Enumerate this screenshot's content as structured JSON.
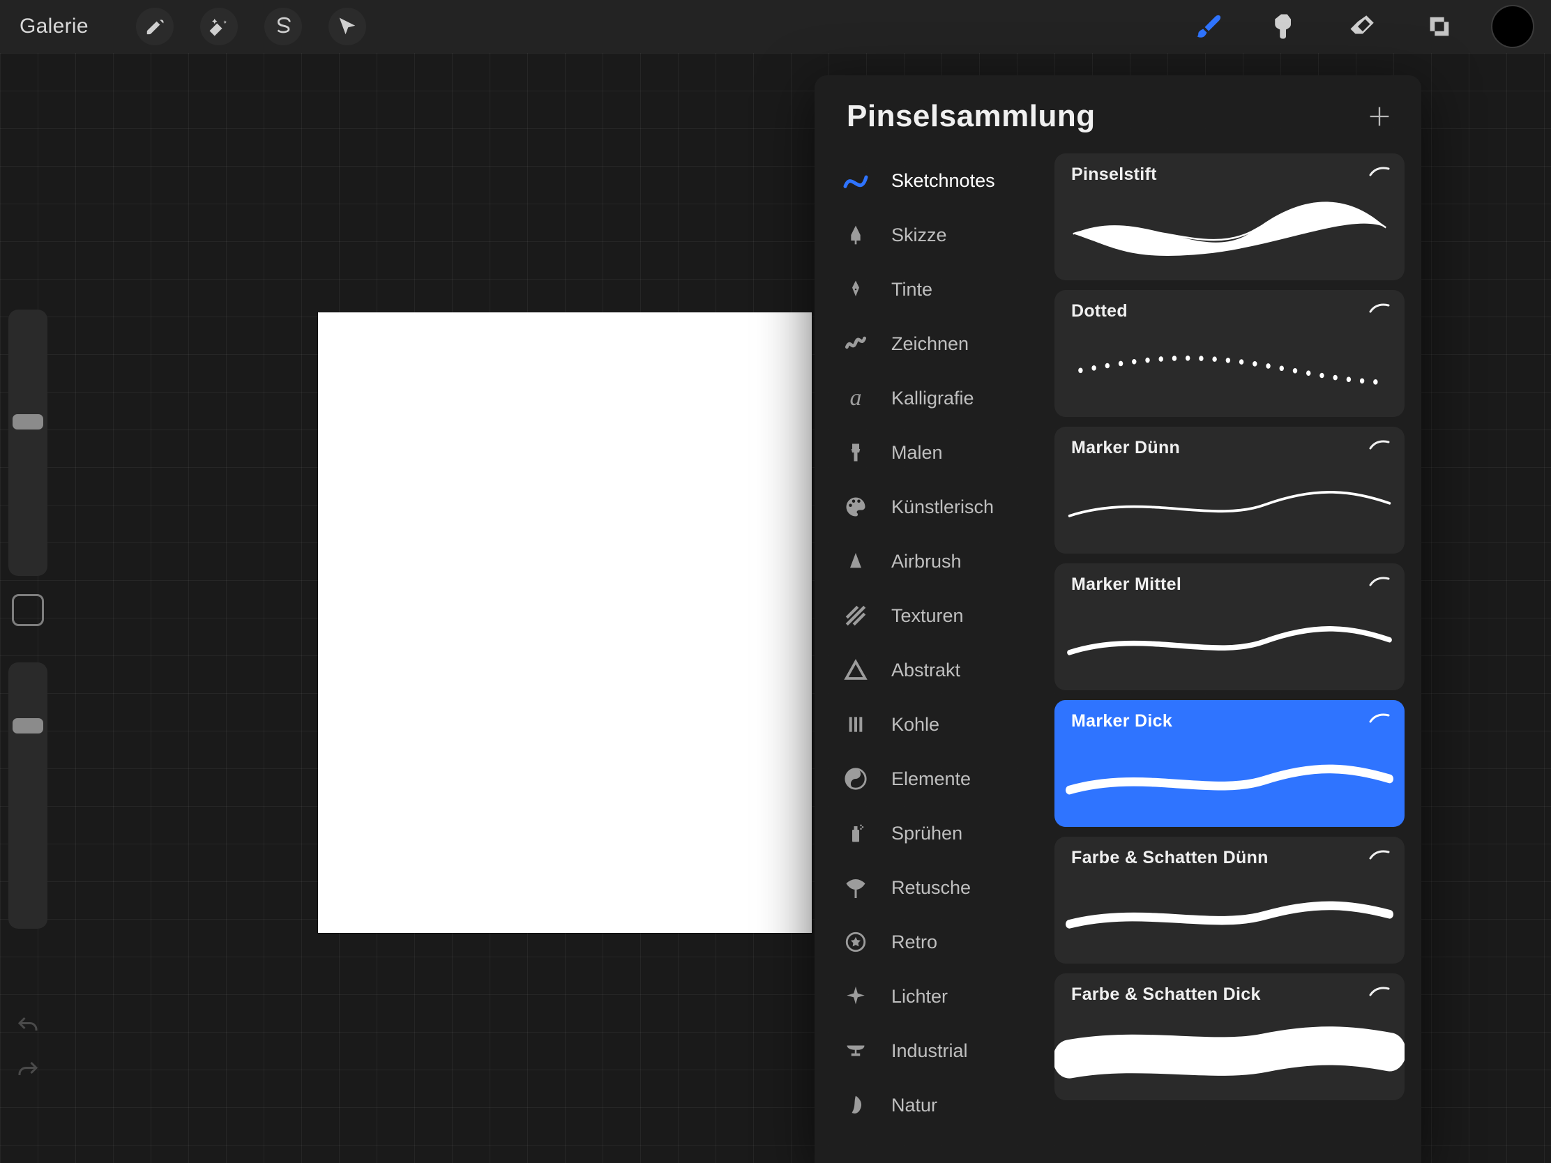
{
  "toolbar": {
    "gallery_label": "Galerie",
    "left_tools": [
      {
        "name": "wrench-icon"
      },
      {
        "name": "magic-wand-icon"
      },
      {
        "name": "select-s-icon"
      },
      {
        "name": "cursor-icon"
      }
    ],
    "right_tools": [
      {
        "name": "brush-icon",
        "active": true
      },
      {
        "name": "smudge-icon"
      },
      {
        "name": "eraser-icon"
      },
      {
        "name": "layers-icon"
      }
    ],
    "color": "#000000"
  },
  "sidebar": {
    "size_slider": 0.55,
    "opacity_slider": 0.78
  },
  "brush_library": {
    "title": "Pinselsammlung",
    "categories": [
      {
        "label": "Sketchnotes",
        "icon": "stroke-curve-icon",
        "active": true
      },
      {
        "label": "Skizze",
        "icon": "pencil-nib-icon"
      },
      {
        "label": "Tinte",
        "icon": "fountain-pen-icon"
      },
      {
        "label": "Zeichnen",
        "icon": "squiggle-icon"
      },
      {
        "label": "Kalligrafie",
        "icon": "cursive-a-icon"
      },
      {
        "label": "Malen",
        "icon": "flat-brush-icon"
      },
      {
        "label": "Künstlerisch",
        "icon": "palette-icon"
      },
      {
        "label": "Airbrush",
        "icon": "spray-cone-icon"
      },
      {
        "label": "Texturen",
        "icon": "hatch-icon"
      },
      {
        "label": "Abstrakt",
        "icon": "triangle-icon"
      },
      {
        "label": "Kohle",
        "icon": "bars-icon"
      },
      {
        "label": "Elemente",
        "icon": "yinyang-icon"
      },
      {
        "label": "Sprühen",
        "icon": "spray-can-icon"
      },
      {
        "label": "Retusche",
        "icon": "fan-brush-icon"
      },
      {
        "label": "Retro",
        "icon": "star-badge-icon"
      },
      {
        "label": "Lichter",
        "icon": "sparkle-icon"
      },
      {
        "label": "Industrial",
        "icon": "anvil-icon"
      },
      {
        "label": "Natur",
        "icon": "leaf-icon"
      }
    ],
    "brushes": [
      {
        "name": "Pinselstift",
        "type": "swell",
        "selected": false
      },
      {
        "name": "Dotted",
        "type": "dotted",
        "selected": false
      },
      {
        "name": "Marker Dünn",
        "type": "thin",
        "selected": false
      },
      {
        "name": "Marker Mittel",
        "type": "medium",
        "selected": false
      },
      {
        "name": "Marker Dick",
        "type": "thick",
        "selected": true
      },
      {
        "name": "Farbe & Schatten Dünn",
        "type": "shadow-thin",
        "selected": false
      },
      {
        "name": "Farbe & Schatten Dick",
        "type": "shadow-thick",
        "selected": false
      }
    ]
  }
}
